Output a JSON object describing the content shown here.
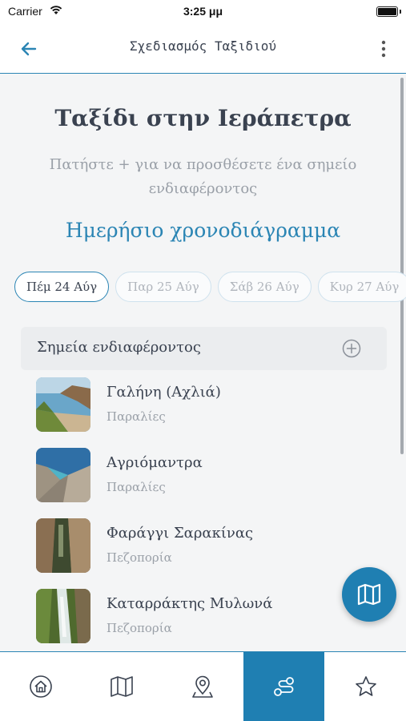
{
  "status_bar": {
    "carrier": "Carrier",
    "time": "3:25 μμ",
    "icons": [
      "wifi-icon",
      "battery-icon"
    ]
  },
  "nav": {
    "title": "Σχεδιασμός Ταξιδιού",
    "back_icon": "arrow-left-icon",
    "more_icon": "more-vertical-icon"
  },
  "trip": {
    "title": "Ταξίδι στην Ιεράπετρα",
    "hint": "Πατήστε + για να προσθέσετε ένα σημείο ενδιαφέροντος",
    "schedule_title": "Ημερήσιο χρονοδιάγραμμα"
  },
  "days": [
    {
      "label": "Πέμ 24 Αύγ",
      "selected": true
    },
    {
      "label": "Παρ 25 Αύγ",
      "selected": false
    },
    {
      "label": "Σάβ 26 Αύγ",
      "selected": false
    },
    {
      "label": "Κυρ 27 Αύγ",
      "selected": false
    }
  ],
  "poi_section": {
    "label": "Σημεία ενδιαφέροντος",
    "add_icon": "plus-circle-icon"
  },
  "pois": [
    {
      "name": "Γαλήνη (Αχλιά)",
      "category": "Παραλίες"
    },
    {
      "name": "Αγριόμαντρα",
      "category": "Παραλίες"
    },
    {
      "name": "Φαράγγι Σαρακίνας",
      "category": "Πεζοπορία"
    },
    {
      "name": "Καταρράκτης Μυλωνά",
      "category": "Πεζοπορία"
    }
  ],
  "fab": {
    "icon": "map-icon"
  },
  "tab_bar": {
    "items": [
      {
        "icon": "home-icon",
        "active": false
      },
      {
        "icon": "map-icon",
        "active": false
      },
      {
        "icon": "location-pin-icon",
        "active": false
      },
      {
        "icon": "route-icon",
        "active": true
      },
      {
        "icon": "star-icon",
        "active": false
      }
    ]
  },
  "colors": {
    "accent": "#2b85b4",
    "accent_dark": "#1f7fb2",
    "text": "#3a4250",
    "muted": "#9aa0a8"
  }
}
